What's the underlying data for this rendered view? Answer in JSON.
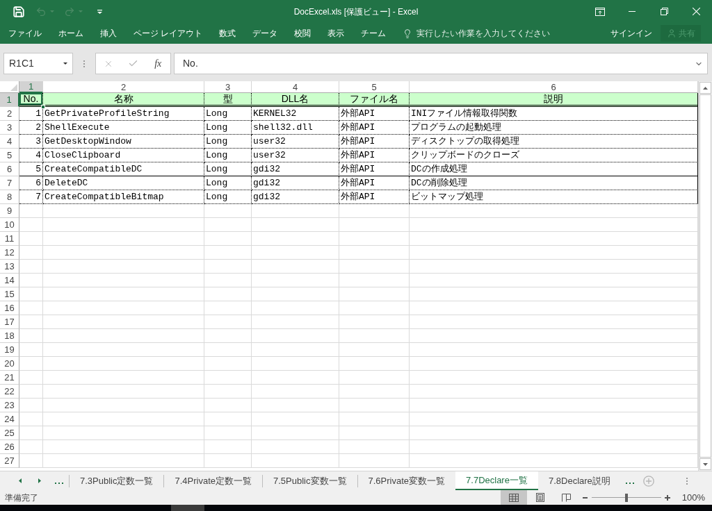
{
  "window": {
    "title": "DocExcel.xls [保護ビュー] - Excel"
  },
  "quick_access": [
    {
      "kind": "save",
      "disabled": false
    },
    {
      "kind": "undo",
      "disabled": true
    },
    {
      "kind": "redo",
      "disabled": true
    },
    {
      "kind": "customize",
      "disabled": false
    }
  ],
  "ribbon": {
    "tabs": [
      "ファイル",
      "ホーム",
      "挿入",
      "ページ レイアウト",
      "数式",
      "データ",
      "校閲",
      "表示",
      "チーム"
    ],
    "tell_me": {
      "placeholder": "実行したい作業を入力してください"
    },
    "sign_in": "サインイン",
    "share": {
      "label": "共有",
      "disabled": true
    }
  },
  "formula_bar": {
    "name_box": "R1C1",
    "buttons": [
      {
        "kind": "cancel",
        "disabled": true
      },
      {
        "kind": "enter",
        "disabled": true
      }
    ],
    "insert_function": "fx",
    "value": "No."
  },
  "sheet": {
    "column_headers": [
      {
        "label": "1",
        "selected": true
      },
      {
        "label": "2",
        "selected": false
      },
      {
        "label": "3",
        "selected": false
      },
      {
        "label": "4",
        "selected": false
      },
      {
        "label": "5",
        "selected": false
      },
      {
        "label": "6",
        "selected": false
      }
    ],
    "row_headers": [
      {
        "label": "1",
        "selected": true
      },
      {
        "label": "2",
        "selected": false
      },
      {
        "label": "3",
        "selected": false
      },
      {
        "label": "4",
        "selected": false
      },
      {
        "label": "5",
        "selected": false
      },
      {
        "label": "6",
        "selected": false
      },
      {
        "label": "7",
        "selected": false
      },
      {
        "label": "8",
        "selected": false
      },
      {
        "label": "9",
        "selected": false
      },
      {
        "label": "10",
        "selected": false
      },
      {
        "label": "11",
        "selected": false
      },
      {
        "label": "12",
        "selected": false
      },
      {
        "label": "13",
        "selected": false
      },
      {
        "label": "14",
        "selected": false
      },
      {
        "label": "15",
        "selected": false
      },
      {
        "label": "16",
        "selected": false
      },
      {
        "label": "17",
        "selected": false
      },
      {
        "label": "18",
        "selected": false
      },
      {
        "label": "19",
        "selected": false
      },
      {
        "label": "20",
        "selected": false
      },
      {
        "label": "21",
        "selected": false
      },
      {
        "label": "22",
        "selected": false
      },
      {
        "label": "23",
        "selected": false
      },
      {
        "label": "24",
        "selected": false
      },
      {
        "label": "25",
        "selected": false
      },
      {
        "label": "26",
        "selected": false
      },
      {
        "label": "27",
        "selected": false
      }
    ],
    "header_row": {
      "cells": [
        {
          "text": "No.",
          "selected": true
        },
        {
          "text": "名称",
          "selected": false
        },
        {
          "text": "型",
          "selected": false
        },
        {
          "text": "DLL名",
          "selected": false
        },
        {
          "text": "ファイル名",
          "selected": false
        },
        {
          "text": "説明",
          "selected": false
        }
      ],
      "double_rule_below": true
    },
    "rows": [
      {
        "cells": [
          "1",
          "GetPrivateProfileString",
          "Long",
          "KERNEL32",
          "外部API",
          "INIファイル情報取得関数"
        ],
        "solid_rule_below": false
      },
      {
        "cells": [
          "2",
          "ShellExecute",
          "Long",
          "shell32.dll",
          "外部API",
          "プログラムの起動処理"
        ],
        "solid_rule_below": false
      },
      {
        "cells": [
          "3",
          "GetDesktopWindow",
          "Long",
          "user32",
          "外部API",
          "ディスクトップの取得処理"
        ],
        "solid_rule_below": false
      },
      {
        "cells": [
          "4",
          "CloseClipboard",
          "Long",
          "user32",
          "外部API",
          "クリップボードのクローズ"
        ],
        "solid_rule_below": false
      },
      {
        "cells": [
          "5",
          "CreateCompatibleDC",
          "Long",
          "gdi32",
          "外部API",
          "DCの作成処理"
        ],
        "solid_rule_below": true
      },
      {
        "cells": [
          "6",
          "DeleteDC",
          "Long",
          "gdi32",
          "外部API",
          "DCの削除処理"
        ],
        "solid_rule_below": false
      },
      {
        "cells": [
          "7",
          "CreateCompatibleBitmap",
          "Long",
          "gdi32",
          "外部API",
          "ビットマップ処理"
        ],
        "solid_rule_below": false
      }
    ]
  },
  "sheet_tabs": [
    {
      "label": "7.3Public定数一覧",
      "selected": false
    },
    {
      "label": "7.4Private定数一覧",
      "selected": false
    },
    {
      "label": "7.5Public変数一覧",
      "selected": false
    },
    {
      "label": "7.6Private変数一覧",
      "selected": false
    },
    {
      "label": "7.7Declare一覧",
      "selected": true
    },
    {
      "label": "7.8Declare説明",
      "selected": false
    }
  ],
  "status_bar": {
    "text": "準備完了",
    "views": [
      {
        "kind": "normal",
        "selected": true
      },
      {
        "kind": "page_layout",
        "selected": false
      },
      {
        "kind": "page_break",
        "selected": false
      }
    ],
    "zoom": {
      "level": 0.5,
      "reading": "100%"
    }
  }
}
